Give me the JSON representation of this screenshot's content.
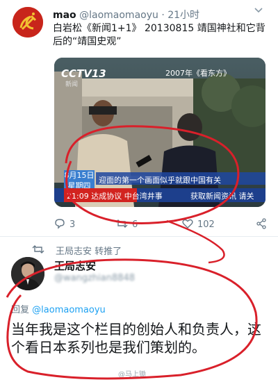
{
  "tweet": {
    "author_name": "mao",
    "author_handle": "@laomaomaoyu",
    "separator": "·",
    "time": "21小时",
    "text": "白岩松《新闻1+1》 20130815 靖国神社和它背后的“靖国史观”",
    "media": {
      "channel_logo": "CCTV13",
      "channel_sub": "新闻",
      "year_caption": "2007年《看东方》",
      "date_box_line1": "8月15日",
      "date_box_line2": "星期四",
      "subtitle": "迎面的第一个画面似乎就跟中国有关",
      "ticker_left": "21:09 达成协议 中台湾井事",
      "ticker_right": "获取新闻资讯  请关"
    },
    "replies": "3",
    "retweets": "6",
    "likes": "102"
  },
  "retweet_banner": {
    "text": "王局志安 转推了"
  },
  "quote": {
    "user_name": "王局志安",
    "user_handle": "@wangzhian8848",
    "reply_to_label": "回复",
    "reply_to_handle": "@laomaomaoyu",
    "body": "当年我是这个栏目的创始人和负责人，这个看日本系列也是我们策划的。"
  },
  "watermark": "@马上锄",
  "colors": {
    "avatar_bg": "#c8251b",
    "link": "#1da1f2",
    "annotation": "#d9202a",
    "muted": "#657786"
  }
}
